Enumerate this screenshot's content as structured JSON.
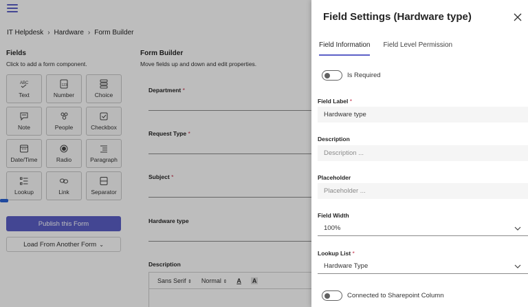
{
  "breadcrumb": [
    "IT Helpdesk",
    "Hardware",
    "Form Builder"
  ],
  "fields_panel": {
    "title": "Fields",
    "subtitle": "Click to add a form component.",
    "tiles": [
      {
        "label": "Text",
        "icon": "text-abc-icon"
      },
      {
        "label": "Number",
        "icon": "number-icon"
      },
      {
        "label": "Choice",
        "icon": "choice-list-icon"
      },
      {
        "label": "Note",
        "icon": "note-icon"
      },
      {
        "label": "People",
        "icon": "people-icon"
      },
      {
        "label": "Checkbox",
        "icon": "checkbox-icon"
      },
      {
        "label": "Date/Time",
        "icon": "calendar-icon"
      },
      {
        "label": "Radio",
        "icon": "radio-icon"
      },
      {
        "label": "Paragraph",
        "icon": "paragraph-icon"
      },
      {
        "label": "Lookup",
        "icon": "lookup-list-icon"
      },
      {
        "label": "Link",
        "icon": "link-icon"
      },
      {
        "label": "Separator",
        "icon": "separator-icon"
      }
    ],
    "publish_label": "Publish this Form",
    "load_label": "Load From Another Form"
  },
  "form_builder": {
    "title": "Form Builder",
    "subtitle": "Move fields up and down and edit properties.",
    "fields": [
      {
        "label": "Department",
        "required": "*"
      },
      {
        "label": "Request Type",
        "required": "*"
      },
      {
        "label": "Subject",
        "required": "*"
      },
      {
        "label": "Hardware type",
        "required": ""
      }
    ],
    "description_label": "Description",
    "toolbar": {
      "font": "Sans Serif",
      "size": "Normal"
    }
  },
  "panel": {
    "title": "Field Settings (Hardware type)",
    "tabs": [
      "Field Information",
      "Field Level Permission"
    ],
    "is_required_label": "Is Required",
    "field_label": {
      "label": "Field Label",
      "required": "*",
      "value": "Hardware type"
    },
    "description": {
      "label": "Description",
      "placeholder": "Description ..."
    },
    "placeholder": {
      "label": "Placeholder",
      "placeholder": "Placeholder ..."
    },
    "field_width": {
      "label": "Field Width",
      "value": "100%"
    },
    "lookup_list": {
      "label": "Lookup List",
      "required": "*",
      "value": "Hardware Type"
    },
    "connected_label": "Connected to Sharepoint Column"
  },
  "colors": {
    "accent": "#5b5fc7",
    "required": "#c4314b"
  }
}
